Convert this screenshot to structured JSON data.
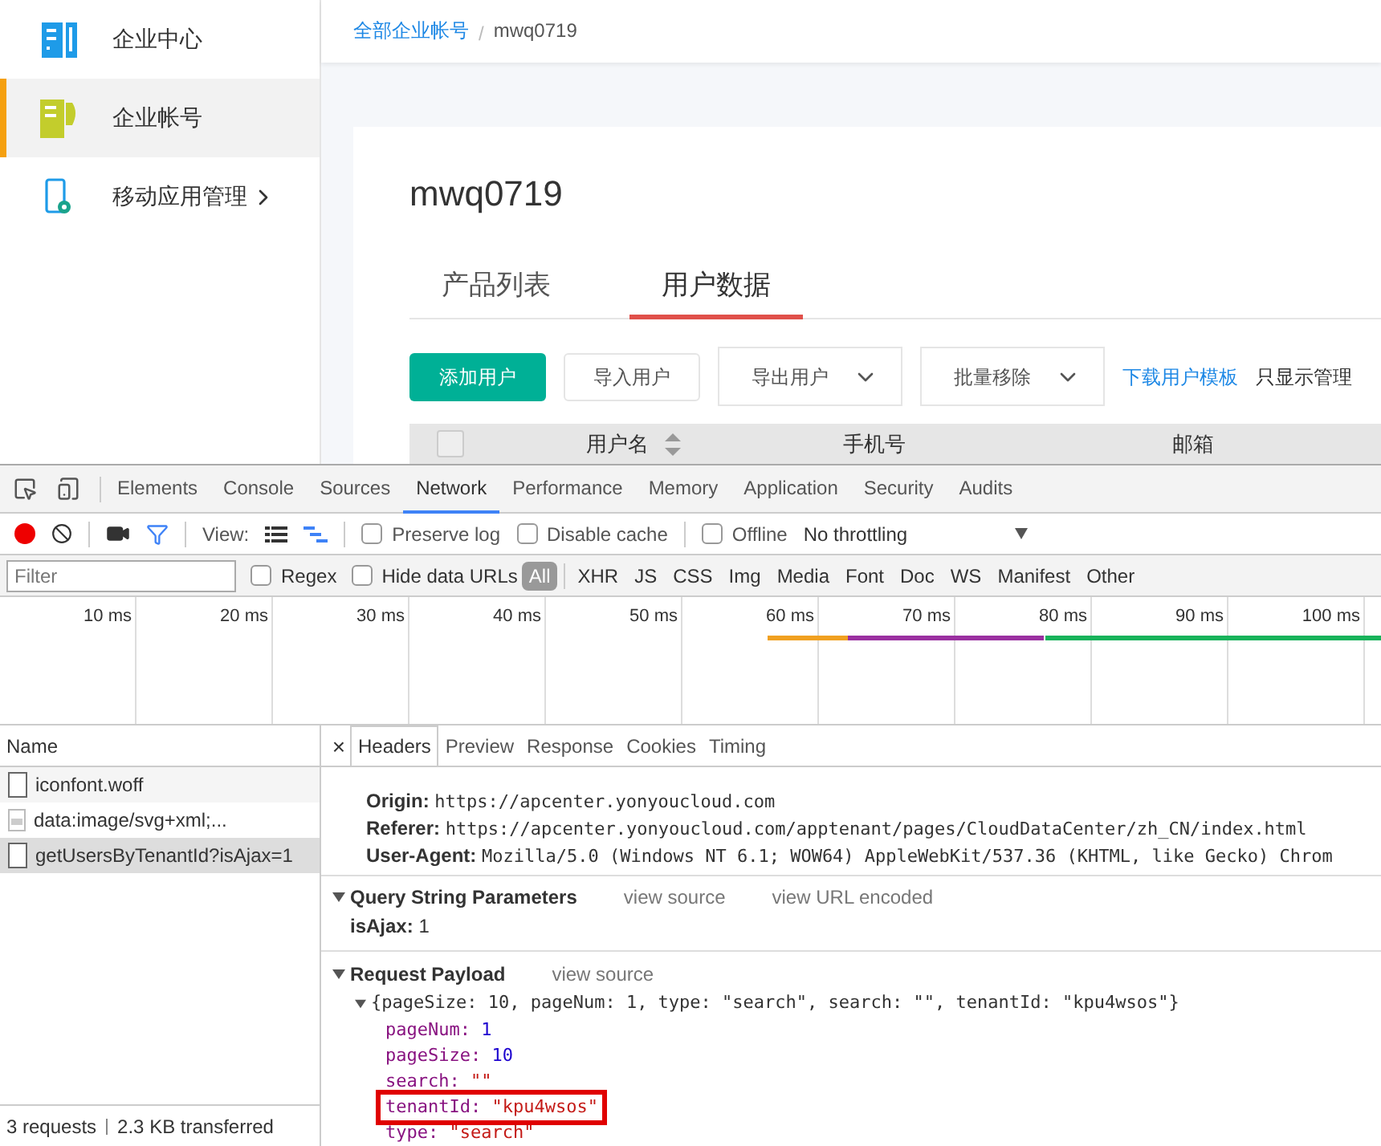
{
  "sidebar": {
    "items": [
      {
        "label": "企业中心",
        "selected": false,
        "expandable": false
      },
      {
        "label": "企业帐号",
        "selected": true,
        "expandable": false
      },
      {
        "label": "移动应用管理",
        "selected": false,
        "expandable": true
      }
    ]
  },
  "breadcrumb": {
    "link": "全部企业帐号",
    "separator": "/",
    "current": "mwq0719"
  },
  "card": {
    "title": "mwq0719",
    "tabs": [
      {
        "label": "产品列表",
        "selected": false
      },
      {
        "label": "用户数据",
        "selected": true
      }
    ],
    "actions": [
      {
        "kind": "primary",
        "label": "添加用户"
      },
      {
        "kind": "plain",
        "label": "导入用户"
      },
      {
        "kind": "dropdown",
        "label": "导出用户"
      },
      {
        "kind": "dropdown",
        "label": "批量移除"
      },
      {
        "kind": "link",
        "label": "下载用户模板"
      },
      {
        "kind": "text",
        "label": "只显示管理"
      }
    ],
    "table": {
      "select_all_checked": false,
      "columns": [
        {
          "label": "用户名",
          "sortable": true
        },
        {
          "label": "手机号",
          "sortable": false
        },
        {
          "label": "邮箱",
          "sortable": false
        }
      ]
    }
  },
  "devtools": {
    "panel_tabs": [
      {
        "label": "Elements",
        "selected": false
      },
      {
        "label": "Console",
        "selected": false
      },
      {
        "label": "Sources",
        "selected": false
      },
      {
        "label": "Network",
        "selected": true
      },
      {
        "label": "Performance",
        "selected": false
      },
      {
        "label": "Memory",
        "selected": false
      },
      {
        "label": "Application",
        "selected": false
      },
      {
        "label": "Security",
        "selected": false
      },
      {
        "label": "Audits",
        "selected": false
      }
    ],
    "toolbar": {
      "view_label": "View:",
      "options": [
        {
          "label": "Preserve log",
          "checked": false
        },
        {
          "label": "Disable cache",
          "checked": false
        },
        {
          "label": "Offline",
          "checked": false
        }
      ],
      "throttling": "No throttling"
    },
    "filter": {
      "placeholder": "Filter",
      "options": [
        {
          "label": "Regex",
          "checked": false
        },
        {
          "label": "Hide data URLs",
          "checked": false
        }
      ],
      "types": [
        {
          "label": "All",
          "selected": true
        },
        {
          "label": "XHR",
          "selected": false
        },
        {
          "label": "JS",
          "selected": false
        },
        {
          "label": "CSS",
          "selected": false
        },
        {
          "label": "Img",
          "selected": false
        },
        {
          "label": "Media",
          "selected": false
        },
        {
          "label": "Font",
          "selected": false
        },
        {
          "label": "Doc",
          "selected": false
        },
        {
          "label": "WS",
          "selected": false
        },
        {
          "label": "Manifest",
          "selected": false
        },
        {
          "label": "Other",
          "selected": false
        }
      ]
    },
    "timeline": {
      "ticks": [
        "10 ms",
        "20 ms",
        "30 ms",
        "40 ms",
        "50 ms",
        "60 ms",
        "70 ms",
        "80 ms",
        "90 ms",
        "100 ms"
      ]
    },
    "requests": {
      "column": "Name",
      "rows": [
        {
          "name": "iconfont.woff",
          "kind": "file",
          "selected": false
        },
        {
          "name": "data:image/svg+xml;...",
          "kind": "image",
          "selected": false
        },
        {
          "name": "getUsersByTenantId?isAjax=1",
          "kind": "file",
          "selected": true
        }
      ]
    },
    "status": {
      "requests": "3 requests",
      "transferred": "2.3 KB transferred"
    },
    "details": {
      "close": "×",
      "tabs": [
        {
          "label": "Headers",
          "selected": true
        },
        {
          "label": "Preview",
          "selected": false
        },
        {
          "label": "Response",
          "selected": false
        },
        {
          "label": "Cookies",
          "selected": false
        },
        {
          "label": "Timing",
          "selected": false
        }
      ],
      "headers": [
        {
          "name": "Origin:",
          "value": "https://apcenter.yonyoucloud.com"
        },
        {
          "name": "Referer:",
          "value": "https://apcenter.yonyoucloud.com/apptenant/pages/CloudDataCenter/zh_CN/index.html"
        },
        {
          "name": "User-Agent:",
          "value": "Mozilla/5.0 (Windows NT 6.1; WOW64) AppleWebKit/537.36 (KHTML, like Gecko) Chrom"
        }
      ],
      "query": {
        "title": "Query String Parameters",
        "expanded": true,
        "links": [
          "view source",
          "view URL encoded"
        ],
        "params": [
          {
            "name": "isAjax:",
            "value": "1"
          }
        ]
      },
      "payload": {
        "title": "Request Payload",
        "expanded": true,
        "links": [
          "view source"
        ],
        "summary_expanded": true,
        "summary": "{pageSize: 10, pageNum: 1, type: \"search\", search: \"\", tenantId: \"kpu4wsos\"}",
        "properties": [
          {
            "key": "pageNum:",
            "value": "1",
            "kind": "number",
            "highlighted": false
          },
          {
            "key": "pageSize:",
            "value": "10",
            "kind": "number",
            "highlighted": false
          },
          {
            "key": "search:",
            "value": "\"\"",
            "kind": "string",
            "highlighted": false
          },
          {
            "key": "tenantId:",
            "value": "\"kpu4wsos\"",
            "kind": "string",
            "highlighted": true
          },
          {
            "key": "type:",
            "value": "\"search\"",
            "kind": "string",
            "highlighted": false
          }
        ]
      }
    }
  }
}
